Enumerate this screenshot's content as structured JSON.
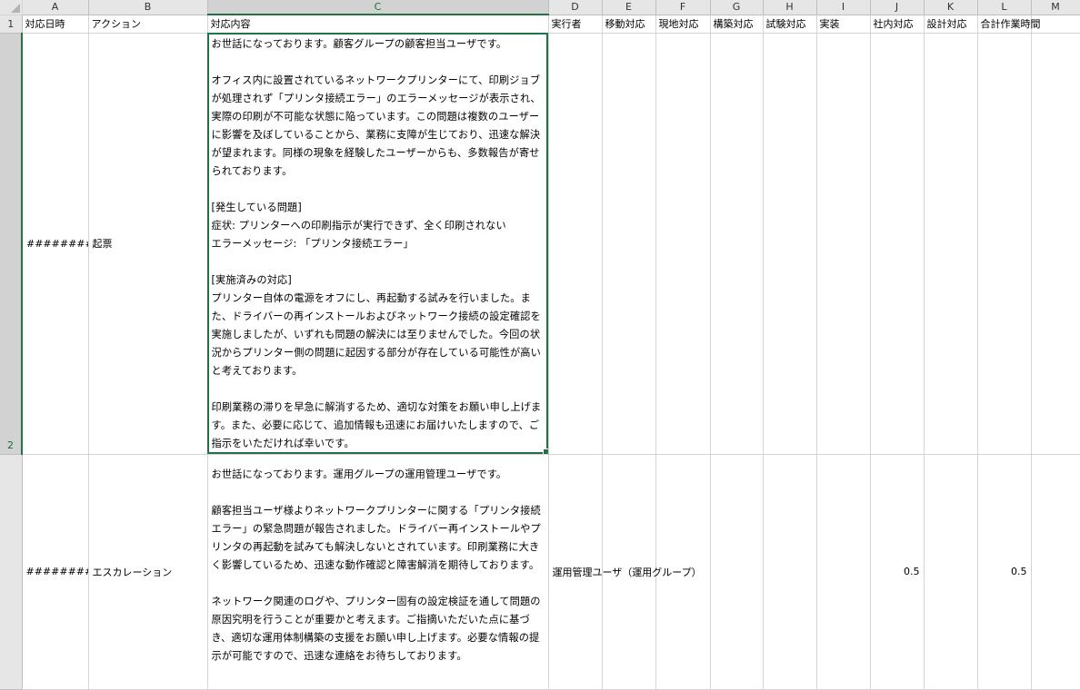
{
  "sheet": {
    "columns": [
      "A",
      "B",
      "C",
      "D",
      "E",
      "F",
      "G",
      "H",
      "I",
      "J",
      "K",
      "L",
      "M"
    ],
    "selected_column": "C",
    "rows": [
      "1",
      "2"
    ],
    "selected_row": "2",
    "headers": {
      "A": "対応日時",
      "B": "アクション",
      "C": "対応内容",
      "D": "実行者",
      "E": "移動対応",
      "F": "現地対応",
      "G": "構築対応",
      "H": "試験対応",
      "I": "実装",
      "J": "社内対応",
      "K": "設計対応",
      "L": "合計作業時間"
    },
    "row2": {
      "date": "#########",
      "action": "起票",
      "content": "お世話になっております。顧客グループの顧客担当ユーザです。\n\nオフィス内に設置されているネットワークプリンターにて、印刷ジョブが処理されず「プリンタ接続エラー」のエラーメッセージが表示され、実際の印刷が不可能な状態に陥っています。この問題は複数のユーザーに影響を及ぼしていることから、業務に支障が生じており、迅速な解決が望まれます。同様の現象を経験したユーザーからも、多数報告が寄せられております。\n\n[発生している問題]\n症状: プリンターへの印刷指示が実行できず、全く印刷されない\nエラーメッセージ: 「プリンタ接続エラー」\n\n[実施済みの対応]\nプリンター自体の電源をオフにし、再起動する試みを行いました。また、ドライバーの再インストールおよびネットワーク接続の設定確認を実施しましたが、いずれも問題の解決には至りませんでした。今回の状況からプリンター側の問題に起因する部分が存在している可能性が高いと考えております。\n\n印刷業務の滞りを早急に解消するため、適切な対策をお願い申し上げます。また、必要に応じて、追加情報も迅速にお届けいたしますので、ご指示をいただければ幸いです。"
    },
    "row3": {
      "date": "#########",
      "action": "エスカレーション",
      "content": "お世話になっております。運用グループの運用管理ユーザです。\n\n顧客担当ユーザ様よりネットワークプリンターに関する「プリンタ接続エラー」の緊急問題が報告されました。ドライバー再インストールやプリンタの再起動を試みても解決しないとされています。印刷業務に大きく影響しているため、迅速な動作確認と障害解消を期待しております。\n\nネットワーク関連のログや、プリンター固有の設定検証を通して問題の原因究明を行うことが重要かと考えます。ご指摘いただいた点に基づき、適切な運用体制構築の支援をお願い申し上げます。必要な情報の提示が可能ですので、迅速な連絡をお待ちしております。",
      "executor": "運用管理ユーザ（運用グループ）",
      "j_value": "0.5",
      "l_value": "0.5"
    }
  }
}
